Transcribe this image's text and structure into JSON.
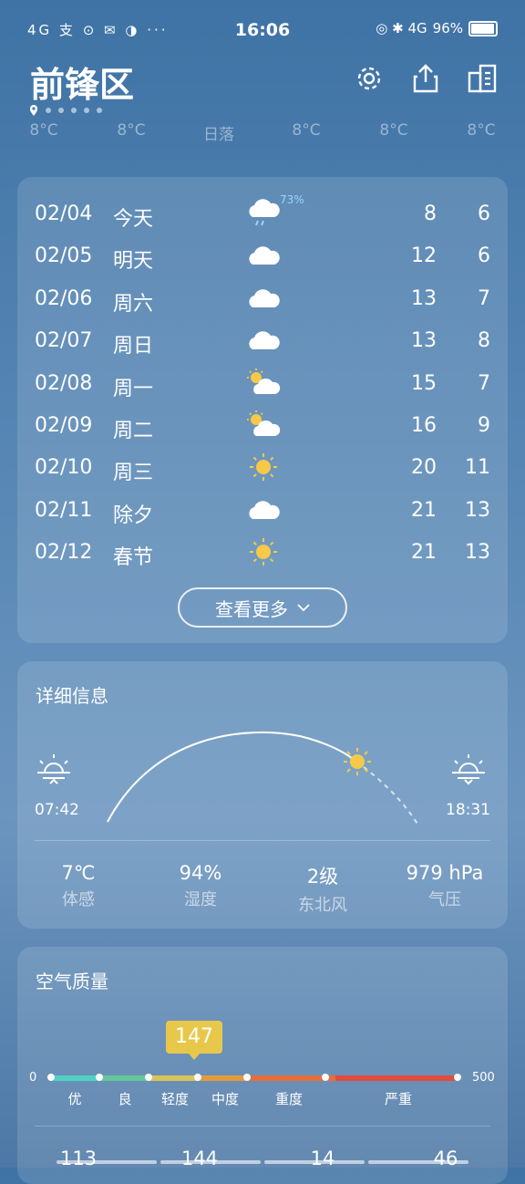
{
  "status_bar": {
    "left_icons": "4G 支 ⊙ ✉ ◑ ···",
    "time": "16:06",
    "battery": "96%",
    "battery_level": 0.96,
    "right_icons": "◎ ✱ 4G"
  },
  "header": {
    "city": "前锋区",
    "page_dots": 6
  },
  "hourly": [
    "8°C",
    "8°C",
    "日落",
    "8°C",
    "8°C",
    "8°C"
  ],
  "forecast": {
    "days": [
      {
        "date": "02/04",
        "day": "今天",
        "icon": "rain-cloud-icon",
        "precip": "73%",
        "high": "8",
        "low": "6"
      },
      {
        "date": "02/05",
        "day": "明天",
        "icon": "cloud-icon",
        "precip": "",
        "high": "12",
        "low": "6"
      },
      {
        "date": "02/06",
        "day": "周六",
        "icon": "cloud-icon",
        "precip": "",
        "high": "13",
        "low": "7"
      },
      {
        "date": "02/07",
        "day": "周日",
        "icon": "cloud-icon",
        "precip": "",
        "high": "13",
        "low": "8"
      },
      {
        "date": "02/08",
        "day": "周一",
        "icon": "partly-cloudy-icon",
        "precip": "",
        "high": "15",
        "low": "7"
      },
      {
        "date": "02/09",
        "day": "周二",
        "icon": "partly-cloudy-icon",
        "precip": "",
        "high": "16",
        "low": "9"
      },
      {
        "date": "02/10",
        "day": "周三",
        "icon": "sun-icon",
        "precip": "",
        "high": "20",
        "low": "11"
      },
      {
        "date": "02/11",
        "day": "除夕",
        "icon": "cloud-icon",
        "precip": "",
        "high": "21",
        "low": "13"
      },
      {
        "date": "02/12",
        "day": "春节",
        "icon": "sun-icon",
        "precip": "",
        "high": "21",
        "low": "13"
      }
    ],
    "more_label": "查看更多"
  },
  "details": {
    "title": "详细信息",
    "sunrise": "07:42",
    "sunset": "18:31",
    "stats": [
      {
        "value": "7℃",
        "label": "体感"
      },
      {
        "value": "94%",
        "label": "湿度"
      },
      {
        "value": "2级",
        "label": "东北风"
      },
      {
        "value": "979 hPa",
        "label": "气压"
      }
    ]
  },
  "air": {
    "title": "空气质量",
    "aqi": "147",
    "scale_min": "0",
    "scale_max": "500",
    "levels": [
      "优",
      "良",
      "轻度",
      "中度",
      "重度",
      "严重"
    ],
    "bottom_values": [
      "113",
      "144",
      "14",
      "46"
    ]
  }
}
